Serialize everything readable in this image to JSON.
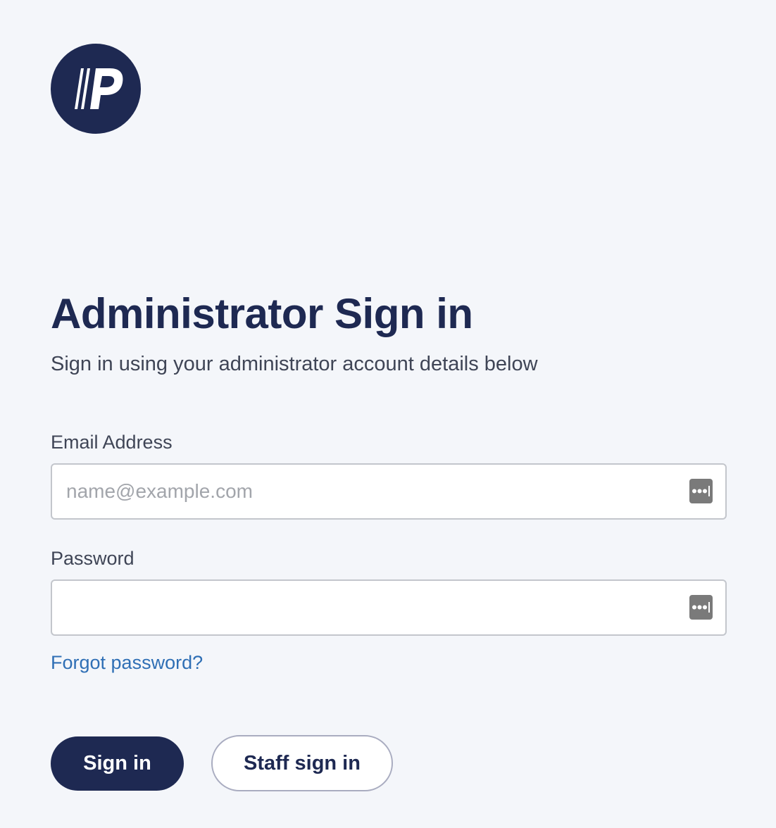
{
  "brand": {
    "logo_icon": "brand-logo-p-icon",
    "logo_color": "#1e2952"
  },
  "page": {
    "title": "Administrator Sign in",
    "subtitle": "Sign in using your administrator account details below"
  },
  "form": {
    "email": {
      "label": "Email Address",
      "value": "",
      "placeholder": "name@example.com",
      "icon": "password-manager-icon"
    },
    "password": {
      "label": "Password",
      "value": "",
      "placeholder": "",
      "icon": "password-manager-icon"
    },
    "forgot_password": "Forgot password?"
  },
  "actions": {
    "sign_in": "Sign in",
    "staff_sign_in": "Staff sign in"
  },
  "colors": {
    "background": "#f4f6fa",
    "primary": "#1e2952",
    "link": "#2f6fb5",
    "input_border": "#c3c6cc"
  }
}
